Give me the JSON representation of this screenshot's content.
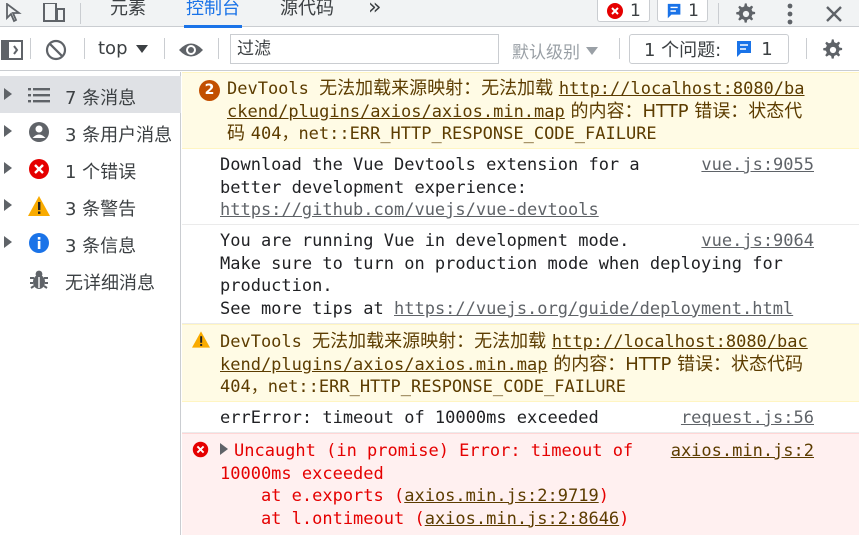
{
  "tabs": [
    {
      "label": "元素"
    },
    {
      "label": "控制台"
    },
    {
      "label": "源代码"
    }
  ],
  "topbar": {
    "more_tabs": "»",
    "error_count": "1",
    "message_count": "1"
  },
  "toolbar": {
    "context": "top",
    "filter_placeholder": "过滤",
    "level": "默认级别",
    "issues_label": "1 个问题:",
    "issues_count": "1"
  },
  "sidebar": {
    "items": [
      {
        "label": "7 条消息",
        "icon": "list-icon"
      },
      {
        "label": "3 条用户消息",
        "icon": "user-icon"
      },
      {
        "label": "1 个错误",
        "icon": "error-icon"
      },
      {
        "label": "3 条警告",
        "icon": "warning-icon"
      },
      {
        "label": "3 条信息",
        "icon": "info-icon"
      },
      {
        "label": "无详细消息",
        "icon": "bug-icon"
      }
    ]
  },
  "console": {
    "msg1": {
      "repeat": "2",
      "prefix": "DevTools ",
      "cjk1": "无法加载来源映射：无法加载 ",
      "url_a": "http://localhost:8080/ba",
      "url_b": "ckend/plugins/axios/axios.min.map",
      "cjk2": " 的内容：HTTP 错误：状态代",
      "cjk3": "码 ",
      "tail": "404，net::ERR_HTTP_RESPONSE_CODE_FAILURE"
    },
    "msg2": {
      "line1": "Download the Vue Devtools extension for a",
      "line2": "better development experience:",
      "url": "https://github.com/vuejs/vue-devtools",
      "source": "vue.js:9055"
    },
    "msg3": {
      "line1": "You are running Vue in development mode.",
      "line2": "Make sure to turn on production mode when deploying for",
      "line3": "production.",
      "line4": "See more tips at ",
      "url": "https://vuejs.org/guide/deployment.html",
      "source": "vue.js:9064"
    },
    "msg4": {
      "prefix": "DevTools ",
      "cjk1": "无法加载来源映射：无法加载 ",
      "url_a": "http://localhost:8080/bac",
      "url_b": "kend/plugins/axios/axios.min.map",
      "cjk2": " 的内容：HTTP 错误：状态代码",
      "tail": "404，net::ERR_HTTP_RESPONSE_CODE_FAILURE"
    },
    "msg5": {
      "text": "errError: timeout of 10000ms exceeded",
      "source": "request.js:56"
    },
    "msg6": {
      "line1": "Uncaught (in promise) Error: timeout of",
      "line2": "10000ms exceeded",
      "frame1_pre": "    at e.exports (",
      "frame1_link": "axios.min.js:2:9719",
      "frame2_pre": "    at l.ontimeout (",
      "frame2_link": "axios.min.js:2:8646",
      "close": ")",
      "source": "axios.min.js:2"
    }
  },
  "colors": {
    "accent": "#1a73e8",
    "error": "#e50000",
    "warning_bg": "#fffbe5",
    "error_bg": "#fff0f0"
  }
}
